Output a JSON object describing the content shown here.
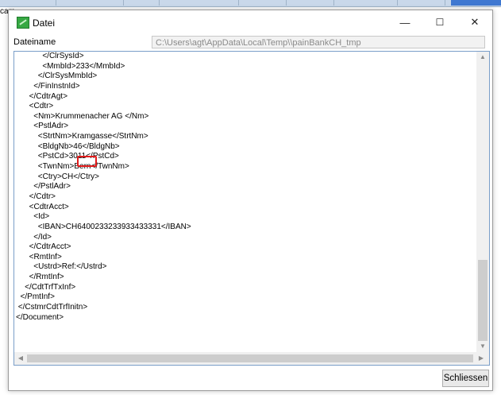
{
  "background": {
    "left_label": "cam"
  },
  "window": {
    "title": "Datei",
    "minimize_label": "—",
    "maximize_label": "☐",
    "close_label": "✕",
    "filename_label": "Dateiname",
    "filename_value": "C:\\Users\\agt\\AppData\\Local\\Temp\\\\painBankCH_tmp",
    "close_button_label": "Schliessen",
    "highlight_color": "#e11b1b"
  },
  "xml": {
    "lines": [
      "            </ClrSysId>",
      "            <MmbId>233</MmbId>",
      "          </ClrSysMmbId>",
      "        </FinInstnId>",
      "      </CdtrAgt>",
      "      <Cdtr>",
      "        <Nm>Krummenacher AG </Nm>",
      "        <PstlAdr>",
      "          <StrtNm>Kramgasse</StrtNm>",
      "          <BldgNb>46</BldgNb>",
      "          <PstCd>3011</PstCd>",
      "          <TwnNm>Bern</TwnNm>",
      "          <Ctry>CH</Ctry>",
      "        </PstlAdr>",
      "      </Cdtr>",
      "      <CdtrAcct>",
      "        <Id>",
      "          <IBAN>CH6400233233933433331</IBAN>",
      "        </Id>",
      "      </CdtrAcct>",
      "      <RmtInf>",
      "        <Ustrd>Ref:</Ustrd>",
      "      </RmtInf>",
      "    </CdtTrfTxInf>",
      "  </PmtInf>",
      " </CstmrCdtTrfInitn>",
      "</Document>"
    ]
  }
}
